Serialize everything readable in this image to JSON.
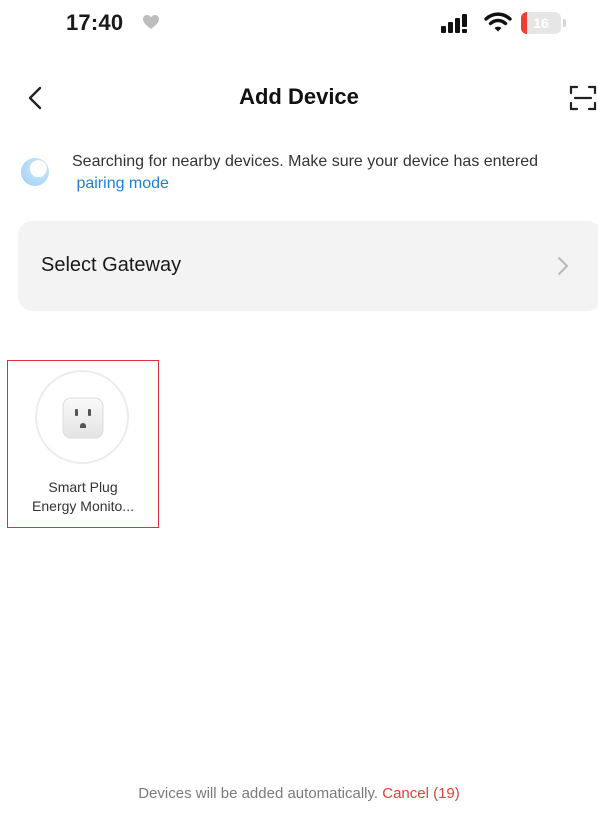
{
  "status_bar": {
    "time": "17:40",
    "battery_level": "16",
    "battery_color": "#ef3d31"
  },
  "nav": {
    "back_icon": "chevron-left-icon",
    "title": "Add Device",
    "scan_icon": "scan-icon"
  },
  "notice": {
    "text": "Searching for nearby devices. Make sure your device has entered",
    "link": "pairing mode"
  },
  "gateway": {
    "label": "Select Gateway",
    "icon": "chevron-right-icon"
  },
  "devices": [
    {
      "icon": "smart-plug-icon",
      "name_line1": "Smart Plug",
      "name_line2": "Energy Monito..."
    }
  ],
  "footer": {
    "text": "Devices will be added automatically.",
    "cancel": "Cancel (19)",
    "cancel_color": "#e0403a"
  },
  "colors": {
    "accent_link": "#1e7fd8",
    "selection_border": "#e0313a"
  }
}
